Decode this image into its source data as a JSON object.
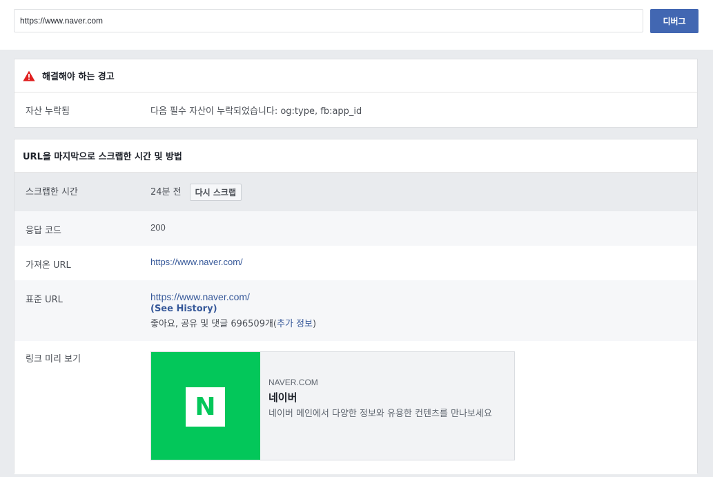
{
  "toolbar": {
    "url_value": "https://www.naver.com",
    "debug_label": "디버그"
  },
  "warnings": {
    "title": "해결해야 하는 경고",
    "row_label": "자산 누락됨",
    "row_value": "다음 필수 자산이 누락되었습니다: og:type, fb:app_id"
  },
  "scrape": {
    "title": "URL을 마지막으로 스크랩한 시간 및 방법",
    "time_label": "스크랩한 시간",
    "time_value": "24분 전",
    "rescrape_label": "다시 스크랩",
    "response_label": "응답 코드",
    "response_value": "200",
    "fetched_label": "가져온 URL",
    "fetched_value": "https://www.naver.com/",
    "canonical_label": "표준 URL",
    "canonical_value": "https://www.naver.com/",
    "see_history": "(See History)",
    "engagement_prefix": "좋아요, 공유 및 댓글 696509개(",
    "more_info": "추가 정보",
    "engagement_suffix": ")",
    "preview_label": "링크 미리 보기"
  },
  "preview": {
    "logo_letter": "N",
    "domain": "NAVER.COM",
    "title": "네이버",
    "description": "네이버 메인에서 다양한 정보와 유용한 컨텐츠를 만나보세요"
  },
  "colors": {
    "accent": "#4267b2",
    "link": "#365899",
    "naver_green": "#03c75a",
    "warning_red": "#e02020"
  }
}
